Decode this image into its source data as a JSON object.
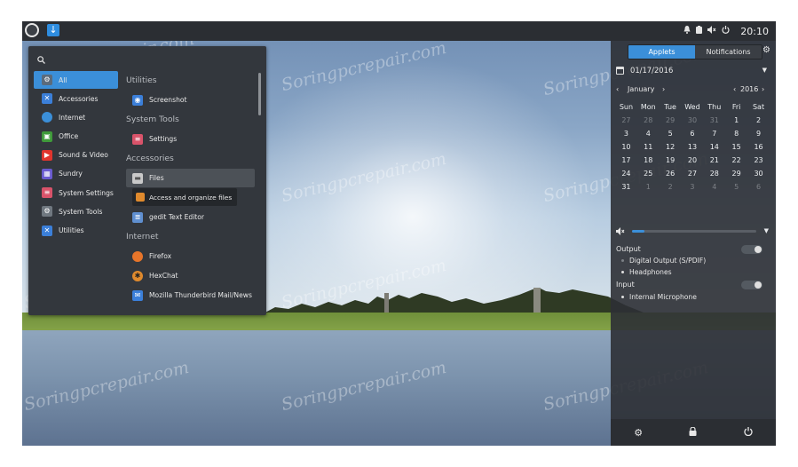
{
  "watermark": "Soringpcrepair.com",
  "panel": {
    "menu_icon": "menu-logo-icon",
    "download_icon": "download-icon",
    "tray_icons": [
      "bell-icon",
      "clipboard-icon",
      "volume-icon",
      "power-icon"
    ],
    "clock": "20:10"
  },
  "menu": {
    "categories": [
      {
        "label": "All",
        "icon": "gear-icon",
        "color": "#5b6b7c"
      },
      {
        "label": "Accessories",
        "icon": "tools-icon",
        "color": "#3b7fd9"
      },
      {
        "label": "Internet",
        "icon": "cloud-icon",
        "color": "#3b8fd9"
      },
      {
        "label": "Office",
        "icon": "office-icon",
        "color": "#3f9a3a"
      },
      {
        "label": "Sound & Video",
        "icon": "play-icon",
        "color": "#e0342d"
      },
      {
        "label": "Sundry",
        "icon": "grid-icon",
        "color": "#6a5bd0"
      },
      {
        "label": "System Settings",
        "icon": "settings-icon",
        "color": "#d9536a"
      },
      {
        "label": "System Tools",
        "icon": "gear-icon",
        "color": "#707880"
      },
      {
        "label": "Utilities",
        "icon": "tools-icon",
        "color": "#3b7fd9"
      }
    ],
    "sections": {
      "utilities": "Utilities",
      "system_tools": "System Tools",
      "accessories": "Accessories",
      "internet": "Internet"
    },
    "apps": {
      "screenshot": "Screenshot",
      "settings": "Settings",
      "files": "Files",
      "files_tooltip": "Access and organize files",
      "gedit": "gedit Text Editor",
      "firefox": "Firefox",
      "hexchat": "HexChat",
      "thunderbird": "Mozilla Thunderbird Mail/News"
    }
  },
  "sidebar": {
    "tabs": [
      "Applets",
      "Notifications"
    ],
    "date": "01/17/2016",
    "month": "January",
    "year": "2016",
    "weekdays": [
      "Sun",
      "Mon",
      "Tue",
      "Wed",
      "Thu",
      "Fri",
      "Sat"
    ],
    "weeks": [
      [
        "27",
        "28",
        "29",
        "30",
        "31",
        "1",
        "2"
      ],
      [
        "3",
        "4",
        "5",
        "6",
        "7",
        "8",
        "9"
      ],
      [
        "10",
        "11",
        "12",
        "13",
        "14",
        "15",
        "16"
      ],
      [
        "17",
        "18",
        "19",
        "20",
        "21",
        "22",
        "23"
      ],
      [
        "24",
        "25",
        "26",
        "27",
        "28",
        "29",
        "30"
      ],
      [
        "31",
        "1",
        "2",
        "3",
        "4",
        "5",
        "6"
      ]
    ],
    "sound": {
      "volume": 0.1,
      "output_label": "Output",
      "outputs": [
        "Digital Output (S/PDIF)",
        "Headphones"
      ],
      "input_label": "Input",
      "inputs": [
        "Internal Microphone"
      ]
    },
    "bottom_icons": [
      "settings-icon",
      "lock-icon",
      "power-icon"
    ]
  },
  "colors": {
    "accent": "#3b8fd9",
    "panel": "#2b2e33",
    "menu_bg": "#33373d"
  }
}
